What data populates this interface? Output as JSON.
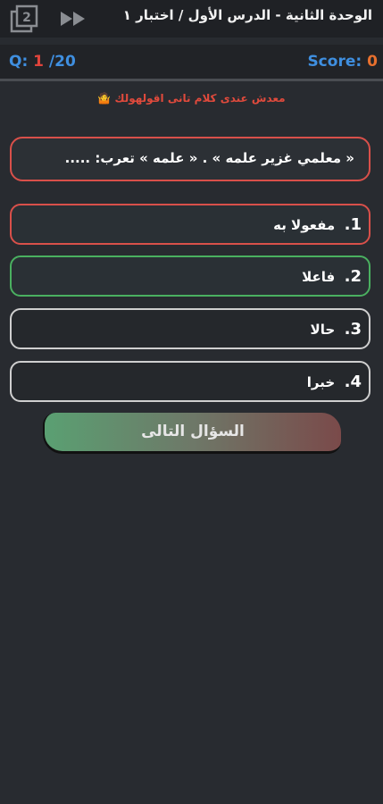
{
  "header": {
    "title": "الوحدة الثانية - الدرس الأول / اختبار ١",
    "app_icon": "stack-icon",
    "skip_icon": "fast-forward-icon"
  },
  "status": {
    "q_prefix": "Q: ",
    "q_current": "1",
    "q_total": " /20",
    "score_label": "Score:",
    "score_value": "0"
  },
  "tagline": {
    "text": "معدش عندى كلام تانى اقولهولك",
    "emoji": "🤷"
  },
  "question": {
    "text": "« معلمي غزير علمه » . « علمه » تعرب: ....."
  },
  "options": [
    {
      "number": "1.",
      "label": "مفعولا به",
      "state": "wrong"
    },
    {
      "number": "2.",
      "label": "فاعلا",
      "state": "correct"
    },
    {
      "number": "3.",
      "label": "حالا",
      "state": "normal"
    },
    {
      "number": "4.",
      "label": "خبرا",
      "state": "normal"
    }
  ],
  "next_button": {
    "label": "السؤال التالى"
  },
  "colors": {
    "background": "#282b30",
    "wrong": "#d9504a",
    "correct": "#4ab060",
    "accent_blue": "#3f8fe0",
    "score_orange": "#e8702e"
  }
}
